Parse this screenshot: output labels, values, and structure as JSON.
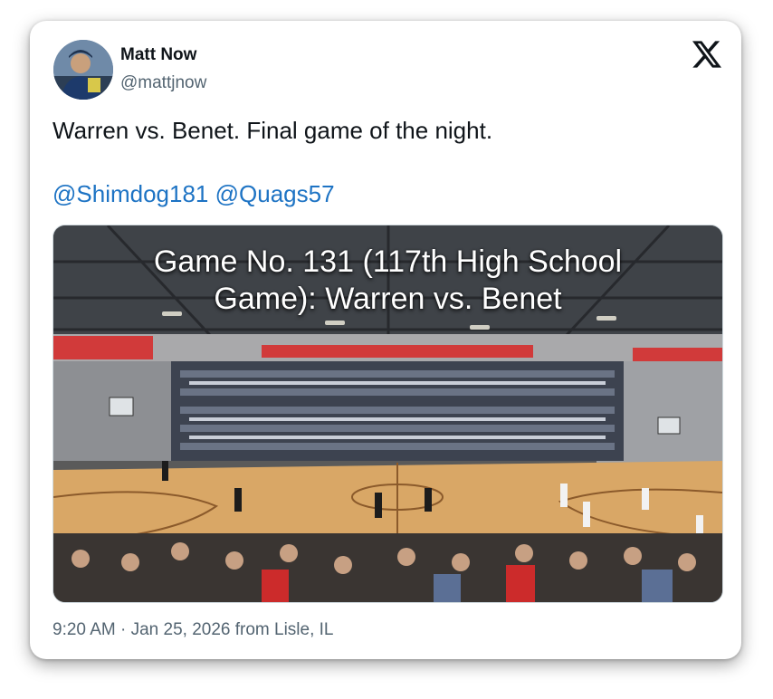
{
  "author": {
    "name": "Matt Now",
    "handle": "@mattjnow"
  },
  "tweet": {
    "text": "Warren vs. Benet. Final game of the night.",
    "mentions": [
      "@Shimdog181",
      "@Quags57"
    ]
  },
  "media": {
    "overlay_line1": "Game No. 131 (117th High School",
    "overlay_line2": "Game): Warren vs. Benet"
  },
  "meta": {
    "timestamp": "9:20 AM · Jan 25, 2026 from Lisle, IL"
  },
  "icons": {
    "platform": "x-logo-icon"
  },
  "colors": {
    "text": "#0f1419",
    "secondary": "#536471",
    "link": "#1d73c4"
  }
}
